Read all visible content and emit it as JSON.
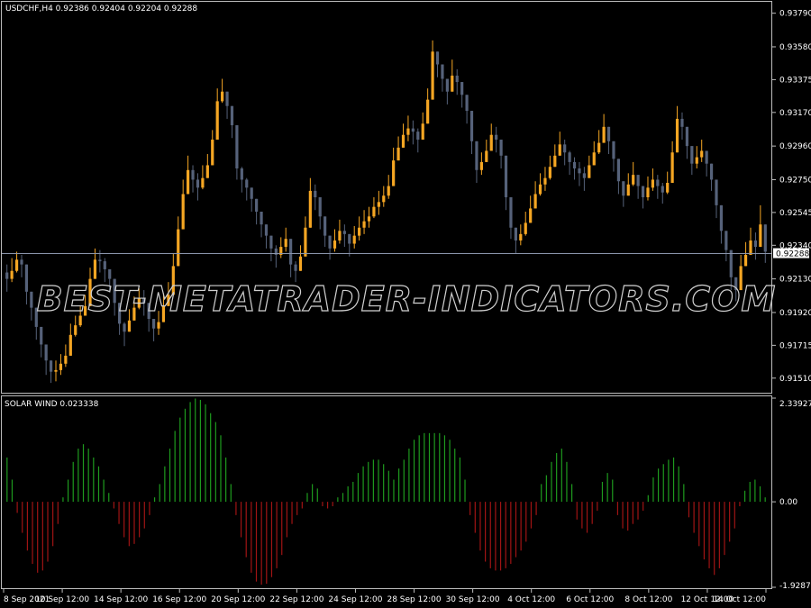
{
  "main_chart": {
    "title": "USDCHF,H4  0.92386 0.92404 0.92204 0.92288",
    "current_price_label": "0.92288",
    "watermark": "BEST-METATRADER-INDICATORS.COM",
    "colors": {
      "bull": "#f5a623",
      "bear": "#56627a",
      "price_line": "#8a95ab"
    }
  },
  "indicator": {
    "title": "SOLAR WIND 0.023338",
    "colors": {
      "positive": "#1e9b1e",
      "negative": "#a01414"
    }
  },
  "chart_data": [
    {
      "type": "candlestick",
      "title": "USDCHF,H4",
      "ylim": [
        0.9143,
        0.9385
      ],
      "current_price": 0.92288,
      "y_ticks": [
        "0.93790",
        "0.93580",
        "0.93375",
        "0.93170",
        "0.92960",
        "0.92750",
        "0.92545",
        "0.92340",
        "0.92130",
        "0.91920",
        "0.91715",
        "0.91510"
      ],
      "x_ticks": [
        "8 Sep 2021",
        "10 Sep 12:00",
        "14 Sep 12:00",
        "16 Sep 12:00",
        "20 Sep 12:00",
        "22 Sep 12:00",
        "24 Sep 12:00",
        "28 Sep 12:00",
        "30 Sep 12:00",
        "4 Oct 12:00",
        "6 Oct 12:00",
        "8 Oct 12:00",
        "12 Oct 12:00",
        "14 Oct 12:00"
      ],
      "close": [
        0.9213,
        0.9218,
        0.9225,
        0.9222,
        0.9205,
        0.9195,
        0.9183,
        0.9172,
        0.9162,
        0.9155,
        0.9156,
        0.916,
        0.9165,
        0.9178,
        0.9184,
        0.919,
        0.9196,
        0.9213,
        0.9225,
        0.9224,
        0.9219,
        0.9213,
        0.9198,
        0.9185,
        0.918,
        0.9187,
        0.9195,
        0.9201,
        0.9198,
        0.9188,
        0.9182,
        0.9186,
        0.9196,
        0.9203,
        0.9221,
        0.9244,
        0.9266,
        0.9281,
        0.9275,
        0.927,
        0.9276,
        0.9284,
        0.93,
        0.9324,
        0.933,
        0.9321,
        0.9309,
        0.9282,
        0.9275,
        0.927,
        0.9263,
        0.9255,
        0.9247,
        0.924,
        0.9232,
        0.9228,
        0.9233,
        0.9238,
        0.9222,
        0.9218,
        0.9227,
        0.9245,
        0.9268,
        0.9264,
        0.9252,
        0.924,
        0.9232,
        0.9237,
        0.9243,
        0.9241,
        0.9235,
        0.924,
        0.9245,
        0.9249,
        0.9252,
        0.9258,
        0.9261,
        0.9265,
        0.9271,
        0.9287,
        0.9295,
        0.9303,
        0.9307,
        0.9305,
        0.93,
        0.931,
        0.9325,
        0.9355,
        0.9347,
        0.9338,
        0.933,
        0.934,
        0.9336,
        0.9328,
        0.9318,
        0.9299,
        0.9281,
        0.9286,
        0.9293,
        0.9303,
        0.93,
        0.929,
        0.9264,
        0.9245,
        0.9237,
        0.9241,
        0.9248,
        0.9257,
        0.9266,
        0.9272,
        0.9276,
        0.9283,
        0.929,
        0.9297,
        0.9292,
        0.9286,
        0.9282,
        0.9279,
        0.9276,
        0.9284,
        0.9292,
        0.9298,
        0.9308,
        0.9299,
        0.9288,
        0.9274,
        0.9265,
        0.9272,
        0.9278,
        0.9271,
        0.9264,
        0.927,
        0.9275,
        0.9271,
        0.9267,
        0.9273,
        0.9292,
        0.9313,
        0.9308,
        0.9296,
        0.9285,
        0.9289,
        0.9293,
        0.9285,
        0.9275,
        0.9259,
        0.9243,
        0.9231,
        0.9214,
        0.9206,
        0.9221,
        0.9228,
        0.9237,
        0.9233,
        0.9247,
        0.923
      ],
      "high": [
        0.9222,
        0.9226,
        0.923,
        0.9228,
        0.9213,
        0.9201,
        0.9189,
        0.9177,
        0.9167,
        0.9162,
        0.9162,
        0.9166,
        0.9172,
        0.9185,
        0.919,
        0.9196,
        0.9203,
        0.922,
        0.9232,
        0.9231,
        0.9226,
        0.9219,
        0.9205,
        0.919,
        0.9186,
        0.9194,
        0.9202,
        0.9207,
        0.9206,
        0.9194,
        0.9188,
        0.9193,
        0.9204,
        0.9211,
        0.9229,
        0.9252,
        0.9275,
        0.929,
        0.9284,
        0.9279,
        0.9284,
        0.9291,
        0.9306,
        0.9332,
        0.9338,
        0.933,
        0.9317,
        0.929,
        0.9283,
        0.9276,
        0.927,
        0.9262,
        0.9254,
        0.9247,
        0.9239,
        0.9234,
        0.9239,
        0.9245,
        0.9229,
        0.9224,
        0.9234,
        0.9252,
        0.9276,
        0.9272,
        0.9259,
        0.9247,
        0.9238,
        0.9244,
        0.925,
        0.9247,
        0.9241,
        0.9246,
        0.9252,
        0.9256,
        0.9258,
        0.9264,
        0.9268,
        0.9271,
        0.9278,
        0.9295,
        0.9302,
        0.931,
        0.9315,
        0.9312,
        0.9307,
        0.9317,
        0.9332,
        0.9362,
        0.9355,
        0.9346,
        0.9337,
        0.935,
        0.9344,
        0.9335,
        0.9325,
        0.9307,
        0.9288,
        0.9292,
        0.93,
        0.931,
        0.9308,
        0.9297,
        0.9273,
        0.9252,
        0.9244,
        0.9247,
        0.9255,
        0.9265,
        0.9274,
        0.9279,
        0.9283,
        0.929,
        0.9297,
        0.9305,
        0.93,
        0.9293,
        0.9289,
        0.9286,
        0.9283,
        0.929,
        0.9299,
        0.9306,
        0.9316,
        0.9307,
        0.9296,
        0.9282,
        0.9272,
        0.9279,
        0.9286,
        0.9278,
        0.9271,
        0.9277,
        0.9282,
        0.9278,
        0.9273,
        0.928,
        0.9299,
        0.9321,
        0.9317,
        0.9304,
        0.9292,
        0.9296,
        0.93,
        0.9293,
        0.9282,
        0.9267,
        0.9251,
        0.9239,
        0.9222,
        0.9214,
        0.9228,
        0.9236,
        0.9245,
        0.9242,
        0.9259,
        0.924
      ],
      "low": [
        0.9205,
        0.9211,
        0.9217,
        0.9214,
        0.9197,
        0.9187,
        0.9175,
        0.9164,
        0.9153,
        0.9148,
        0.9149,
        0.9153,
        0.9158,
        0.9171,
        0.9177,
        0.9183,
        0.919,
        0.9205,
        0.9218,
        0.9217,
        0.9211,
        0.9205,
        0.919,
        0.9178,
        0.9171,
        0.918,
        0.9188,
        0.9194,
        0.919,
        0.918,
        0.9174,
        0.9178,
        0.9189,
        0.9196,
        0.9213,
        0.9237,
        0.9258,
        0.9274,
        0.9267,
        0.9262,
        0.9269,
        0.9277,
        0.9293,
        0.9316,
        0.9323,
        0.9313,
        0.9301,
        0.9275,
        0.9267,
        0.9262,
        0.9255,
        0.9247,
        0.9239,
        0.9232,
        0.9224,
        0.922,
        0.9226,
        0.923,
        0.9214,
        0.9211,
        0.922,
        0.9237,
        0.926,
        0.9256,
        0.9244,
        0.9233,
        0.9225,
        0.923,
        0.9235,
        0.9233,
        0.9227,
        0.9232,
        0.9237,
        0.9241,
        0.9245,
        0.9251,
        0.9253,
        0.9258,
        0.9263,
        0.928,
        0.9287,
        0.9296,
        0.9299,
        0.9297,
        0.9292,
        0.9303,
        0.9317,
        0.9348,
        0.9339,
        0.933,
        0.9322,
        0.9333,
        0.9328,
        0.932,
        0.931,
        0.9291,
        0.9273,
        0.9278,
        0.9286,
        0.9296,
        0.9292,
        0.9282,
        0.9256,
        0.9238,
        0.9229,
        0.9234,
        0.924,
        0.925,
        0.9258,
        0.9265,
        0.9268,
        0.9275,
        0.9283,
        0.929,
        0.9284,
        0.9278,
        0.9275,
        0.9271,
        0.9268,
        0.9277,
        0.9285,
        0.9291,
        0.93,
        0.9291,
        0.928,
        0.9266,
        0.9258,
        0.9265,
        0.9271,
        0.9263,
        0.9257,
        0.9262,
        0.9268,
        0.9263,
        0.926,
        0.9266,
        0.9285,
        0.9306,
        0.93,
        0.9288,
        0.9278,
        0.9282,
        0.9286,
        0.9277,
        0.9268,
        0.9251,
        0.9235,
        0.9224,
        0.9206,
        0.9199,
        0.9213,
        0.9221,
        0.923,
        0.9225,
        0.924,
        0.9223
      ]
    },
    {
      "type": "bar",
      "title": "SOLAR WIND",
      "ylim": [
        -1.928749,
        2.339273
      ],
      "y_ticks": [
        "2.339273",
        "0.00",
        "-1.928749"
      ],
      "values": [
        1.0,
        0.5,
        -0.25,
        -0.7,
        -1.1,
        -1.4,
        -1.6,
        -1.55,
        -1.35,
        -1.0,
        -0.5,
        0.1,
        0.5,
        0.9,
        1.2,
        1.3,
        1.2,
        1.0,
        0.8,
        0.5,
        0.2,
        -0.15,
        -0.5,
        -0.8,
        -1.0,
        -0.95,
        -0.8,
        -0.6,
        -0.3,
        0.1,
        0.4,
        0.8,
        1.2,
        1.6,
        1.9,
        2.1,
        2.25,
        2.33,
        2.3,
        2.2,
        2.0,
        1.8,
        1.5,
        1.0,
        0.4,
        -0.3,
        -0.8,
        -1.25,
        -1.6,
        -1.8,
        -1.87,
        -1.85,
        -1.7,
        -1.5,
        -1.2,
        -0.8,
        -0.5,
        -0.3,
        -0.15,
        0.2,
        0.4,
        0.3,
        -0.1,
        -0.15,
        -0.1,
        0.1,
        0.2,
        0.35,
        0.45,
        0.65,
        0.8,
        0.9,
        0.95,
        0.95,
        0.85,
        0.7,
        0.5,
        0.75,
        0.95,
        1.2,
        1.4,
        1.5,
        1.55,
        1.55,
        1.55,
        1.55,
        1.5,
        1.4,
        1.2,
        1.0,
        0.5,
        -0.3,
        -0.7,
        -1.1,
        -1.35,
        -1.5,
        -1.55,
        -1.55,
        -1.5,
        -1.4,
        -1.25,
        -1.1,
        -0.9,
        -0.6,
        -0.3,
        0.4,
        0.6,
        0.9,
        1.1,
        1.2,
        0.9,
        0.4,
        -0.4,
        -0.6,
        -0.7,
        -0.5,
        -0.2,
        0.45,
        0.65,
        0.5,
        -0.3,
        -0.6,
        -0.65,
        -0.5,
        -0.4,
        -0.2,
        0.15,
        0.55,
        0.75,
        0.85,
        0.95,
        1.0,
        0.8,
        0.4,
        -0.35,
        -0.7,
        -1.0,
        -1.3,
        -1.5,
        -1.65,
        -1.5,
        -1.2,
        -0.9,
        -0.6,
        -0.1,
        0.25,
        0.45,
        0.5,
        0.35,
        0.1
      ]
    }
  ]
}
